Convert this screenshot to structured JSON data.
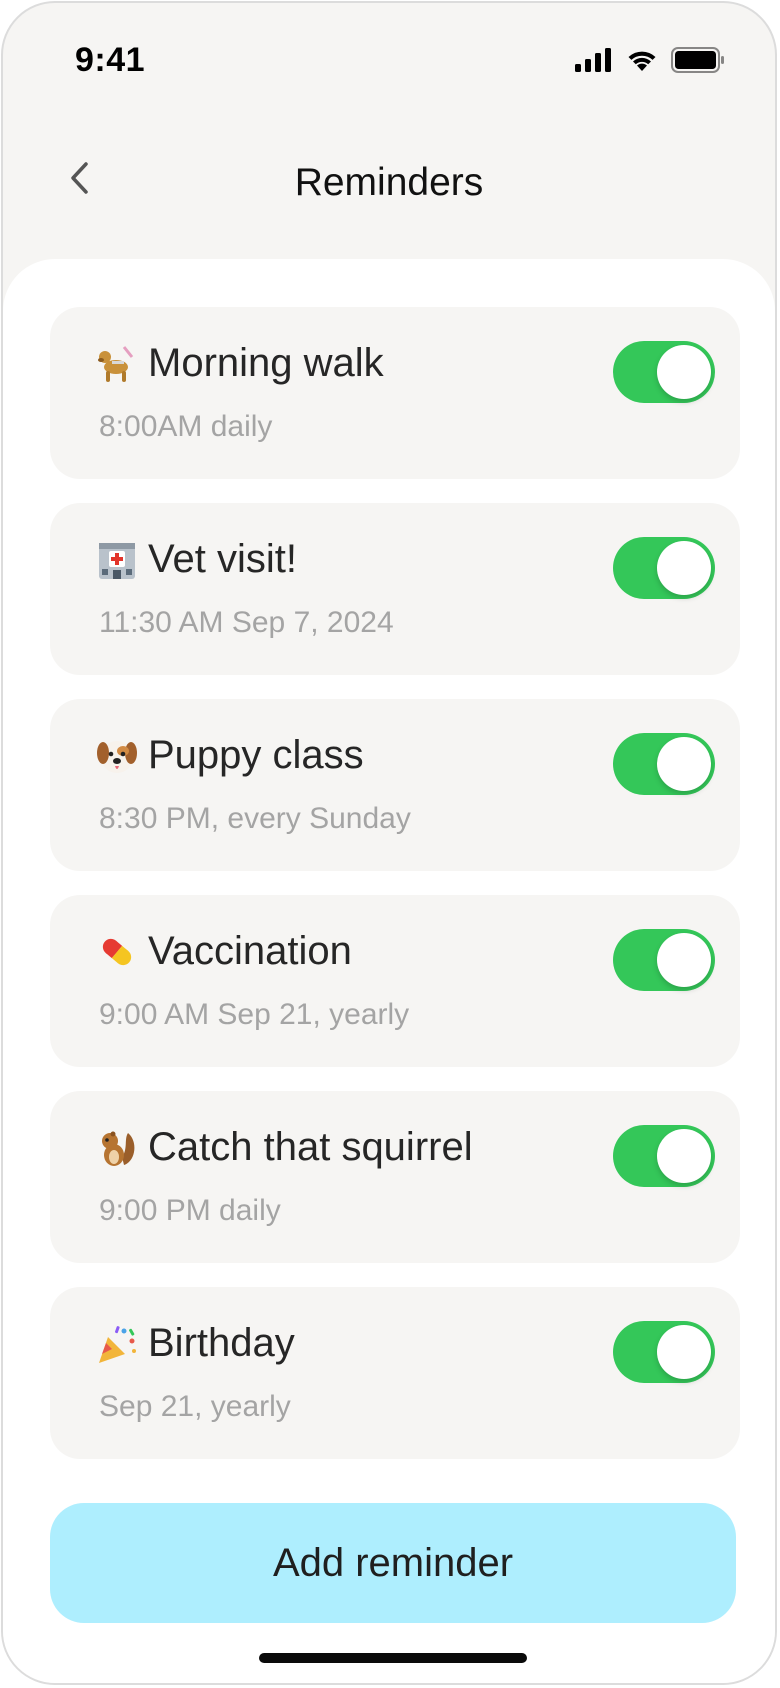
{
  "status_bar": {
    "time": "9:41",
    "icons": [
      "cellular-signal-icon",
      "wifi-icon",
      "battery-icon"
    ]
  },
  "header": {
    "title": "Reminders",
    "back_icon": "chevron-left-icon"
  },
  "reminders": [
    {
      "emoji": "guide-dog",
      "title": "Morning walk",
      "subtitle": "8:00AM daily",
      "enabled": true
    },
    {
      "emoji": "hospital",
      "title": "Vet visit!",
      "subtitle": "11:30 AM Sep 7, 2024",
      "enabled": true
    },
    {
      "emoji": "dog-face",
      "title": "Puppy class",
      "subtitle": "8:30 PM, every Sunday",
      "enabled": true
    },
    {
      "emoji": "pill",
      "title": "Vaccination",
      "subtitle": "9:00 AM Sep 21, yearly",
      "enabled": true
    },
    {
      "emoji": "chipmunk",
      "title": "Catch that squirrel",
      "subtitle": "9:00 PM daily",
      "enabled": true
    },
    {
      "emoji": "party-popper",
      "title": "Birthday",
      "subtitle": "Sep 21, yearly",
      "enabled": true
    }
  ],
  "add_button": {
    "label": "Add reminder"
  },
  "colors": {
    "toggle_on": "#34c759",
    "add_button_bg": "#aeeefe",
    "card_bg": "#f6f5f3",
    "subtitle": "#a4a4a4"
  }
}
